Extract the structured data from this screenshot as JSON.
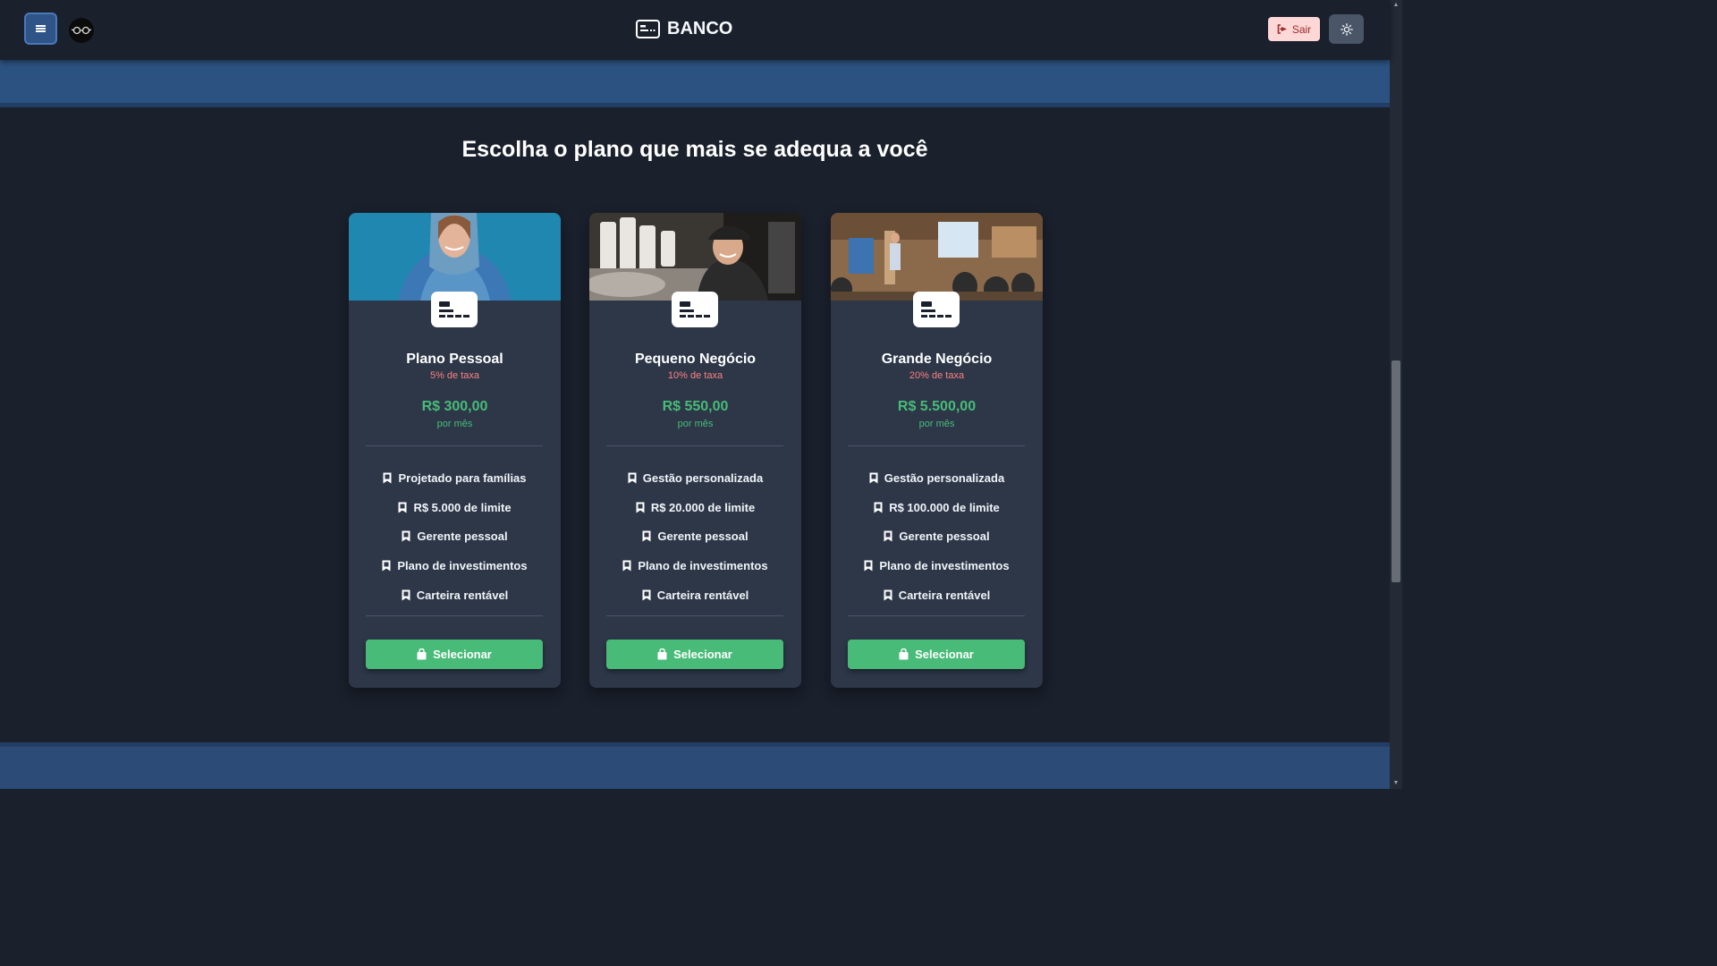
{
  "header": {
    "brand": "BANCO",
    "logout_label": "Sair"
  },
  "section": {
    "title": "Escolha o plano que mais se adequa a você"
  },
  "plans": [
    {
      "name": "Plano Pessoal",
      "fee": "5% de taxa",
      "price": "R$ 300,00",
      "period": "por mês",
      "features": [
        "Projetado para famílias",
        "R$ 5.000 de limite",
        "Gerente pessoal",
        "Plano de investimentos",
        "Carteira rentável"
      ],
      "button": "Selecionar"
    },
    {
      "name": "Pequeno Negócio",
      "fee": "10% de taxa",
      "price": "R$ 550,00",
      "period": "por mês",
      "features": [
        "Gestão personalizada",
        "R$ 20.000 de limite",
        "Gerente pessoal",
        "Plano de investimentos",
        "Carteira rentável"
      ],
      "button": "Selecionar"
    },
    {
      "name": "Grande Negócio",
      "fee": "20% de taxa",
      "price": "R$ 5.500,00",
      "period": "por mês",
      "features": [
        "Gestão personalizada",
        "R$ 100.000 de limite",
        "Gerente pessoal",
        "Plano de investimentos",
        "Carteira rentável"
      ],
      "button": "Selecionar"
    }
  ],
  "colors": {
    "background": "#1a202c",
    "card": "#2d3748",
    "accent_green": "#48bb78",
    "fee_red": "#fc8181",
    "band_blue": "#2c5282"
  },
  "icons": {
    "menu": "hamburger-icon",
    "avatar": "glasses-icon",
    "brand": "card-icon",
    "logout": "sign-out-icon",
    "theme": "sun-icon",
    "feature": "bookmark-icon",
    "select": "shopping-bag-icon"
  }
}
